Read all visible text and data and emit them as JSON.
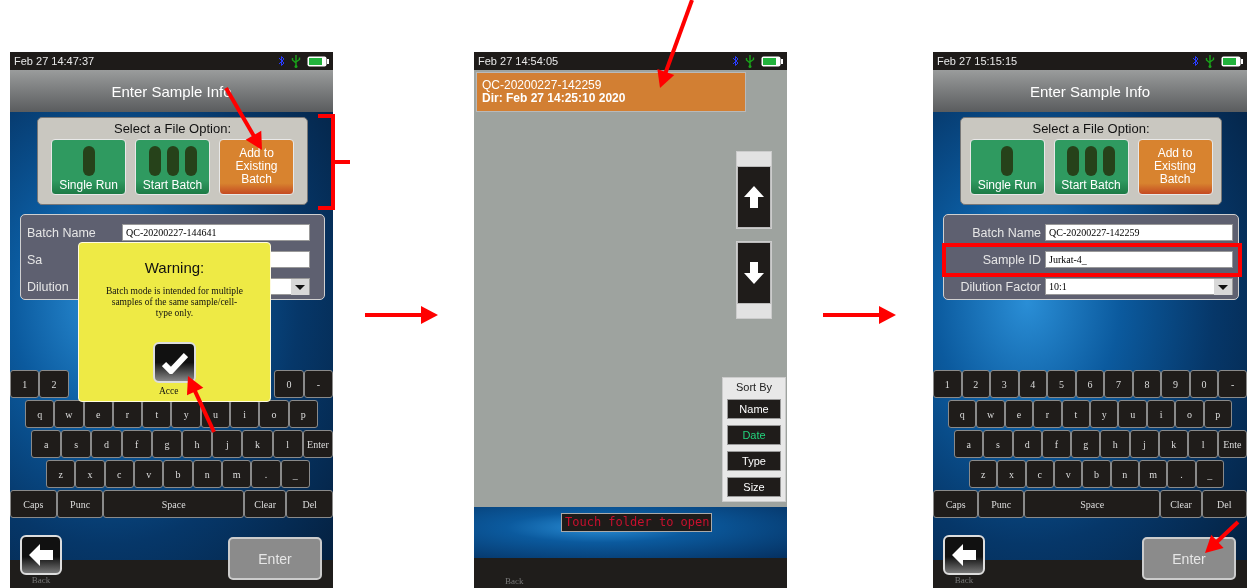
{
  "screens": [
    {
      "kind": "entry",
      "status_bar": {
        "time": "Feb 27 14:47:37"
      },
      "title": "Enter Sample Info",
      "file_options": {
        "heading": "Select a File Option:",
        "options": [
          {
            "kind": "single",
            "label": "Single Run"
          },
          {
            "kind": "batch",
            "label": "Start Batch"
          },
          {
            "kind": "existing",
            "label": "Add to Existing Batch"
          }
        ]
      },
      "form": {
        "fields": [
          {
            "kind": "text",
            "label": "Batch Name",
            "value": "QC-20200227-144641"
          },
          {
            "kind": "text",
            "label": "Sa"
          },
          {
            "kind": "dropdown",
            "label": "Dilution"
          }
        ]
      },
      "dialog": {
        "title": "Warning:",
        "message": "Batch mode is intended for multiple samples of the same sample/cell-type only.",
        "accept_label": "Acce"
      },
      "keyboard": {
        "rows": [
          {
            "kind": "digits",
            "leading": [
              "1",
              "2"
            ],
            "trailing": [
              "0",
              "-"
            ]
          },
          {
            "kind": "top",
            "leading": [
              "q",
              "w",
              "e",
              "r",
              "t",
              "y",
              "u",
              "i",
              "o",
              "p"
            ]
          },
          {
            "kind": "home",
            "leading": [
              "a",
              "s",
              "d",
              "f",
              "g",
              "h",
              "j",
              "k",
              "l",
              "Enter"
            ]
          },
          {
            "kind": "bottom",
            "leading": [
              "z",
              "x",
              "c",
              "v",
              "b",
              "n",
              "m",
              ".",
              "_"
            ]
          },
          {
            "kind": "function",
            "leading": [
              "Caps",
              "Punc",
              "Space",
              "Clear",
              "Del"
            ]
          }
        ]
      },
      "back_label": "Back",
      "enter_label": "Enter"
    },
    {
      "kind": "browser",
      "status_bar": {
        "time": "Feb 27 14:54:05"
      },
      "files": [
        {
          "name": "QC-20200227-142259",
          "detail": "Dir: Feb 27 14:25:10 2020"
        }
      ],
      "sort": {
        "heading": "Sort By",
        "options": [
          {
            "label": "Name",
            "selected": false
          },
          {
            "label": "Date",
            "selected": true
          },
          {
            "label": "Type",
            "selected": false
          },
          {
            "label": "Size",
            "selected": false
          }
        ]
      },
      "message": "Touch folder to open",
      "back_label": "Back"
    },
    {
      "kind": "entry",
      "status_bar": {
        "time": "Feb 27 15:15:15"
      },
      "title": "Enter Sample Info",
      "file_options": {
        "heading": "Select a File Option:",
        "options": [
          {
            "kind": "single",
            "label": "Single Run"
          },
          {
            "kind": "batch",
            "label": "Start Batch"
          },
          {
            "kind": "existing",
            "label": "Add to Existing Batch"
          }
        ]
      },
      "form": {
        "fields": [
          {
            "kind": "text",
            "label": "Batch Name",
            "value": "QC-20200227-142259"
          },
          {
            "kind": "text",
            "label": "Sample ID",
            "value": "Jurkat-4_"
          },
          {
            "kind": "dropdown",
            "label": "Dilution Factor",
            "value": "10:1"
          }
        ]
      },
      "keyboard": {
        "rows": [
          {
            "kind": "digits",
            "leading": [
              "1",
              "2",
              "3",
              "4",
              "5",
              "6",
              "7",
              "8",
              "9",
              "0",
              "-"
            ]
          },
          {
            "kind": "top",
            "leading": [
              "q",
              "w",
              "e",
              "r",
              "t",
              "y",
              "u",
              "i",
              "o",
              "p"
            ]
          },
          {
            "kind": "home",
            "leading": [
              "a",
              "s",
              "d",
              "f",
              "g",
              "h",
              "j",
              "k",
              "l",
              "Ente"
            ]
          },
          {
            "kind": "bottom",
            "leading": [
              "z",
              "x",
              "c",
              "v",
              "b",
              "n",
              "m",
              ".",
              "_"
            ]
          },
          {
            "kind": "function",
            "leading": [
              "Caps",
              "Punc",
              "Space",
              "Clear",
              "Del"
            ]
          }
        ]
      },
      "back_label": "Back",
      "enter_label": "Enter"
    }
  ],
  "annotations": [
    {
      "kind": "arrow"
    },
    {
      "kind": "bracket"
    },
    {
      "kind": "arrow"
    },
    {
      "kind": "arrow"
    },
    {
      "kind": "arrow"
    },
    {
      "kind": "arrow"
    },
    {
      "kind": "highlight_box"
    },
    {
      "kind": "arrow"
    }
  ]
}
